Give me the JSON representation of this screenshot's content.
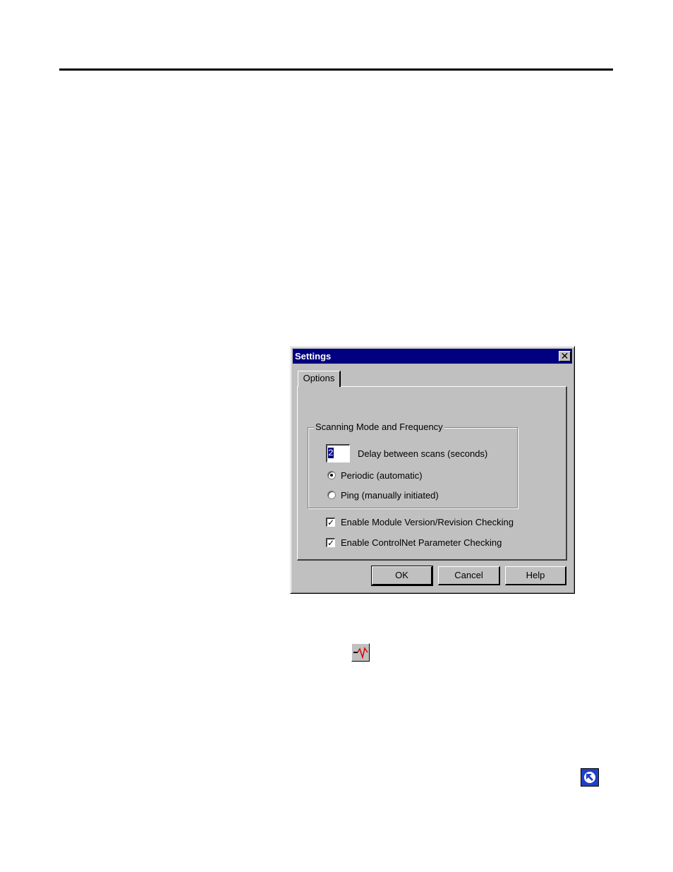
{
  "dialog": {
    "title": "Settings",
    "close_glyph": "✕",
    "tabs": [
      {
        "label": "Options",
        "selected": true
      }
    ],
    "group": {
      "legend": "Scanning Mode and Frequency",
      "delay_value": "2",
      "delay_label": "Delay between scans (seconds)",
      "radios": [
        {
          "label": "Periodic (automatic)",
          "checked": true
        },
        {
          "label": "Ping (manually initiated)",
          "checked": false
        }
      ]
    },
    "checkboxes": [
      {
        "label": "Enable Module Version/Revision Checking",
        "checked": true
      },
      {
        "label": "Enable ControlNet Parameter Checking",
        "checked": true
      }
    ],
    "buttons": {
      "ok": "OK",
      "cancel": "Cancel",
      "help": "Help"
    }
  },
  "icons": {
    "waveform": "waveform-toolbar-icon",
    "return_arrow": "return-arrow-icon"
  },
  "colors": {
    "title_bar": "#000080",
    "dialog_face": "#c0c0c0",
    "waveform_line": "#e00000",
    "return_icon_bg": "#2040c8"
  }
}
